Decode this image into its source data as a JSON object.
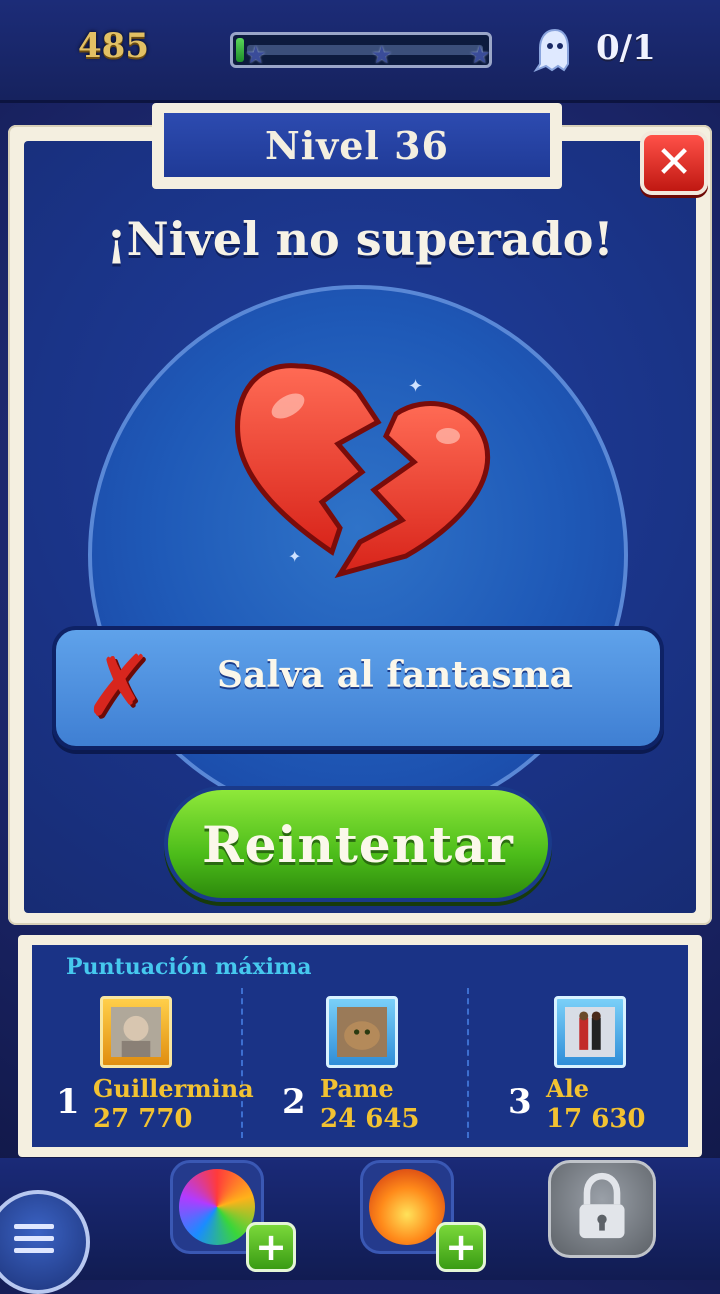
{
  "hud": {
    "score": "485",
    "progress_fraction": 0.03,
    "stars": [
      "star",
      "star",
      "star"
    ],
    "ghost_icon": "ghost-icon",
    "ghost_count": "0/1"
  },
  "dialog": {
    "level_title": "Nivel 36",
    "close_icon": "close-icon",
    "headline": "¡Nivel no superado!",
    "heart_icon": "broken-heart-icon",
    "goal_icon": "failed-x-icon",
    "goal_text": "Salva al fantasma",
    "retry_label": "Reintentar"
  },
  "leaderboard": {
    "title": "Puntuación máxima",
    "entries": [
      {
        "rank": "1",
        "name": "Guillermina",
        "score": "27 770",
        "frame": "gold"
      },
      {
        "rank": "2",
        "name": "Pame",
        "score": "24 645",
        "frame": "blue"
      },
      {
        "rank": "3",
        "name": "Ale",
        "score": "17 630",
        "frame": "blue"
      }
    ]
  },
  "bottom_bar": {
    "menu_icon": "menu-icon",
    "boosters": [
      {
        "icon": "rainbow-ball-icon",
        "plus": "+"
      },
      {
        "icon": "fire-ball-icon",
        "plus": "+"
      }
    ],
    "locked_icon": "padlock-icon"
  },
  "colors": {
    "accent_green": "#4cbc1a",
    "close_red": "#c01812",
    "panel_blue": "#1a3386",
    "gold_text": "#f2c232",
    "title_cyan": "#46c8ee"
  }
}
